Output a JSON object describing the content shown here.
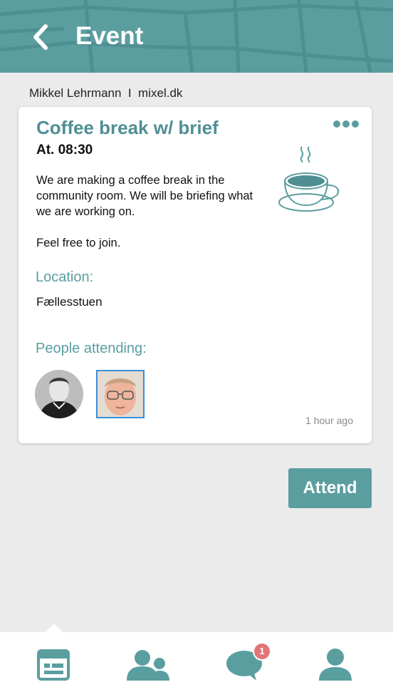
{
  "header": {
    "title": "Event"
  },
  "author_line": "Mikkel Lehrmann  I  mixel.dk",
  "event": {
    "title": "Coffee break w/ brief",
    "time": "At. 08:30",
    "description": [
      "We are making a coffee break in the community room. We will be briefing what we are working on.",
      "Feel free to join."
    ],
    "location_label": "Location:",
    "location_value": "Fællesstuen",
    "attending_label": "People attending:",
    "timestamp": "1 hour ago"
  },
  "attend_button": "Attend",
  "nav": {
    "items": [
      "events-icon",
      "people-icon",
      "chat-icon",
      "profile-icon"
    ],
    "chat_badge": "1"
  },
  "colors": {
    "accent": "#5b9ea0",
    "title": "#4f8f93",
    "badge": "#e07575",
    "background": "#ebebeb"
  }
}
